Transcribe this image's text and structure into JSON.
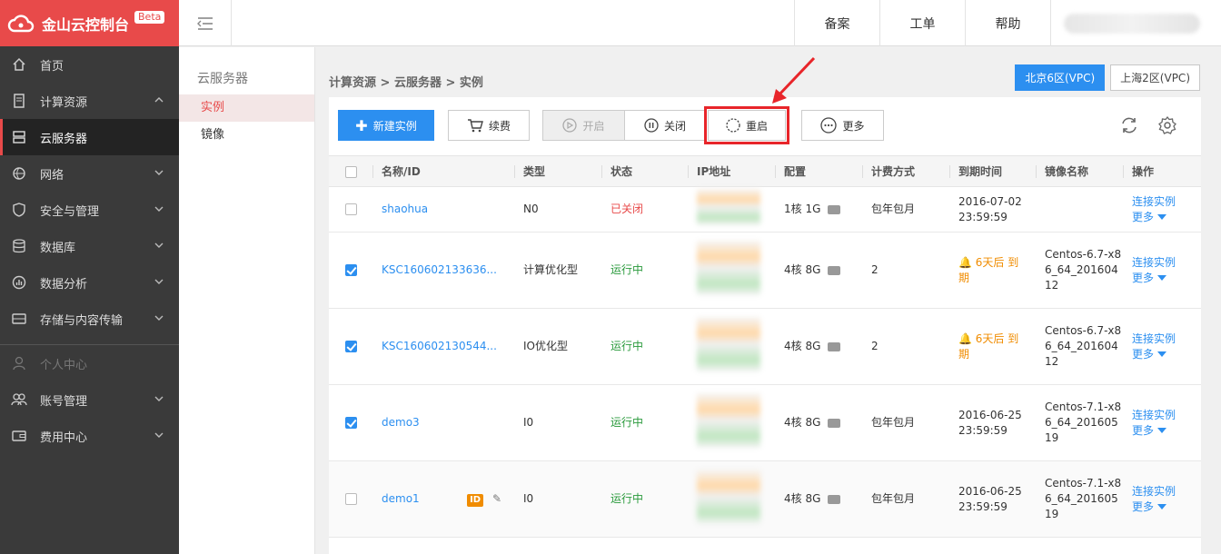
{
  "brand": {
    "title": "金山云控制台",
    "beta": "Beta"
  },
  "sidebar": {
    "items": [
      {
        "label": "首页",
        "icon": "home-icon"
      },
      {
        "label": "计算资源",
        "icon": "compute-icon"
      },
      {
        "label": "云服务器",
        "icon": "server-icon"
      },
      {
        "label": "网络",
        "icon": "network-icon"
      },
      {
        "label": "安全与管理",
        "icon": "shield-icon"
      },
      {
        "label": "数据库",
        "icon": "database-icon"
      },
      {
        "label": "数据分析",
        "icon": "analytics-icon"
      },
      {
        "label": "存储与内容传输",
        "icon": "storage-icon"
      },
      {
        "label": "个人中心",
        "icon": "user-icon"
      },
      {
        "label": "账号管理",
        "icon": "account-icon"
      },
      {
        "label": "费用中心",
        "icon": "wallet-icon"
      }
    ]
  },
  "topbar": {
    "links": [
      "备案",
      "工单",
      "帮助"
    ]
  },
  "subnav": {
    "header": "云服务器",
    "items": [
      "实例",
      "镜像"
    ]
  },
  "breadcrumb": "计算资源 > 云服务器 > 实例",
  "regions": [
    "北京6区(VPC)",
    "上海2区(VPC)"
  ],
  "toolbar": {
    "create": "新建实例",
    "renew": "续费",
    "start": "开启",
    "stop": "关闭",
    "restart": "重启",
    "more": "更多"
  },
  "table": {
    "headers": [
      "名称/ID",
      "类型",
      "状态",
      "IP地址",
      "配置",
      "计费方式",
      "到期时间",
      "镜像名称",
      "操作"
    ],
    "rows": [
      {
        "name": "shaohua",
        "type": "N0",
        "status": "已关闭",
        "config": "1核 1G",
        "billing": "包年包月",
        "expire1": "2016-07-02",
        "expire2": "23:59:59",
        "image": "",
        "checked": false,
        "warn": false
      },
      {
        "name": "KSC160602133636...",
        "type": "计算优化型",
        "status": "运行中",
        "config": "4核 8G",
        "billing": "2",
        "expire1": "6天后 到",
        "expire2": "期",
        "image": "Centos-6.7-x86_64_20160412",
        "checked": true,
        "warn": true
      },
      {
        "name": "KSC160602130544...",
        "type": "IO优化型",
        "status": "运行中",
        "config": "4核 8G",
        "billing": "2",
        "expire1": "6天后 到",
        "expire2": "期",
        "image": "Centos-6.7-x86_64_20160412",
        "checked": true,
        "warn": true
      },
      {
        "name": "demo3",
        "type": "I0",
        "status": "运行中",
        "config": "4核 8G",
        "billing": "包年包月",
        "expire1": "2016-06-25",
        "expire2": "23:59:59",
        "image": "Centos-7.1-x86_64_20160519",
        "checked": true,
        "warn": false
      },
      {
        "name": "demo1",
        "type": "I0",
        "status": "运行中",
        "config": "4核 8G",
        "billing": "包年包月",
        "expire1": "2016-06-25",
        "expire2": "23:59:59",
        "image": "Centos-7.1-x86_64_20160519",
        "checked": false,
        "warn": false,
        "id_badge": "ID"
      }
    ],
    "action_connect": "连接实例",
    "action_more": "更多"
  }
}
